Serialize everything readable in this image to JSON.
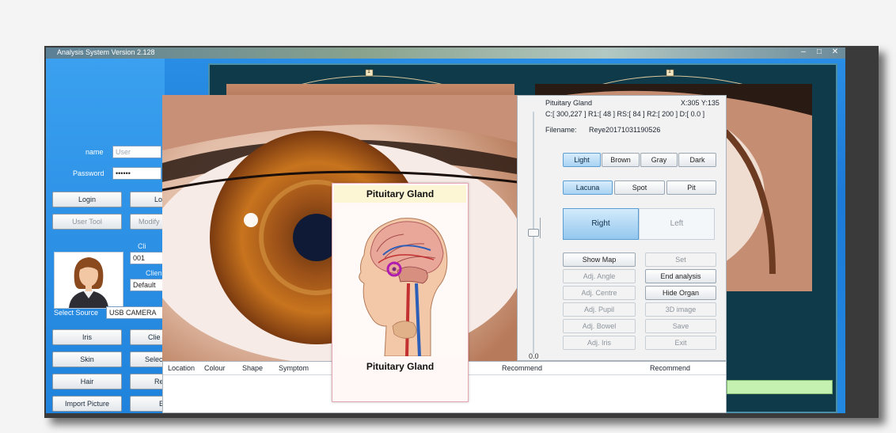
{
  "window": {
    "title": "Analysis System Version 2.128",
    "minimize": "–",
    "restore": "□",
    "close": "✕"
  },
  "login": {
    "name_label": "name",
    "name_placeholder": "User",
    "password_label": "Password",
    "password_value": "••••••",
    "login_button": "Login",
    "login_button_partial": "Lo",
    "user_tool_button": "User Tool",
    "modify_button_partial": "Modify",
    "client_label_1": "Cli",
    "client_value_1": "001",
    "client_label_2": "Clien",
    "client_value_2": "Default",
    "select_source_label": "Select Source",
    "select_source_value": "USB CAMERA"
  },
  "nav_buttons": [
    {
      "label": "Iris",
      "partner": "Clie"
    },
    {
      "label": "Skin",
      "partner": "Selec"
    },
    {
      "label": "Hair",
      "partner": "Re"
    },
    {
      "label": "Import Picture",
      "partner": "E"
    }
  ],
  "behind_images": {
    "left_marker": "1",
    "right_marker": "1"
  },
  "control": {
    "organ": "Pituitary Gland",
    "coords": "X:305 Y:135",
    "params": "C:[ 300,227 ] R1:[ 48 ] RS:[ 84 ] R2:[ 200 ] D:[ 0.0 ]",
    "filename_label": "Filename:",
    "filename_value": "Reye20171031190526",
    "color_buttons": [
      "Light",
      "Brown",
      "Gray",
      "Dark"
    ],
    "mark_buttons": [
      "Lacuna",
      "Spot",
      "Pit"
    ],
    "side_right": "Right",
    "side_left": "Left",
    "left_column": [
      "Show Map",
      "Adj. Angle",
      "Adj. Centre",
      "Adj. Pupil",
      "Adj. Bowel",
      "Adj. Iris"
    ],
    "right_column": [
      "Set",
      "End analysis",
      "Hide Organ",
      "3D image",
      "Save",
      "Exit"
    ],
    "slider_value": "0.0",
    "slider_level": 0.5
  },
  "table": {
    "headers": [
      "Location",
      "Colour",
      "Shape",
      "Symptom",
      "Recommend",
      "Recommend"
    ]
  },
  "popup": {
    "title": "Pituitary Gland",
    "caption": "Pituitary Gland"
  },
  "colors": {
    "app_blue": "#1f82dc",
    "dark_panel": "#0e3a4a",
    "active_button": "#a9d3f3",
    "popup_highlight": "#b01bb0"
  }
}
